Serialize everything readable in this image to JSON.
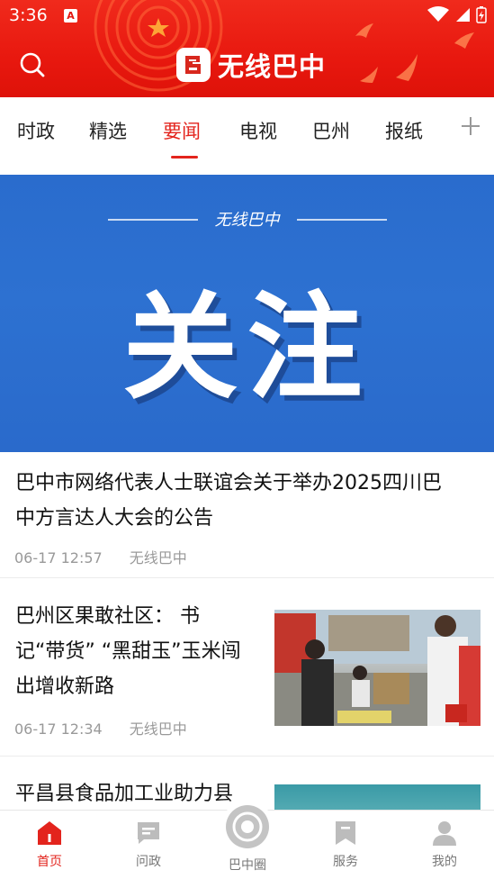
{
  "status_bar": {
    "time": "3:36",
    "app_badge": "A"
  },
  "header": {
    "app_name": "无线巴中",
    "logo_glyph": "巴",
    "search_icon": "search-icon"
  },
  "tabs": [
    {
      "label": "时政"
    },
    {
      "label": "精选"
    },
    {
      "label": "要闻",
      "active": true
    },
    {
      "label": "电视"
    },
    {
      "label": "巴州"
    },
    {
      "label": "报纸"
    }
  ],
  "banner": {
    "small_text": "无线巴中",
    "big_text": "关注"
  },
  "articles": [
    {
      "title_line1": "巴中市网络代表人士联谊会关于举办2025四川巴",
      "title_line2": "中方言达人大会的公告",
      "time": "06-17 12:57",
      "source": "无线巴中"
    },
    {
      "title_line1": "巴州区果敢社区： 书",
      "title_line2": "记“带货” “黑甜玉”玉米闯",
      "title_line3": "出增收新路",
      "time": "06-17 12:34",
      "source": "无线巴中"
    },
    {
      "title_line1": "平昌县食品加工业助力县"
    }
  ],
  "bottom_nav": [
    {
      "label": "首页",
      "icon": "home-icon",
      "active": true
    },
    {
      "label": "问政",
      "icon": "message-icon"
    },
    {
      "label": "巴中圈",
      "icon": "circle-icon"
    },
    {
      "label": "服务",
      "icon": "bookmark-icon"
    },
    {
      "label": "我的",
      "icon": "user-icon"
    }
  ],
  "colors": {
    "brand_red": "#e3241d",
    "header_red": "#e8180f",
    "banner_blue": "#2d71d1"
  }
}
